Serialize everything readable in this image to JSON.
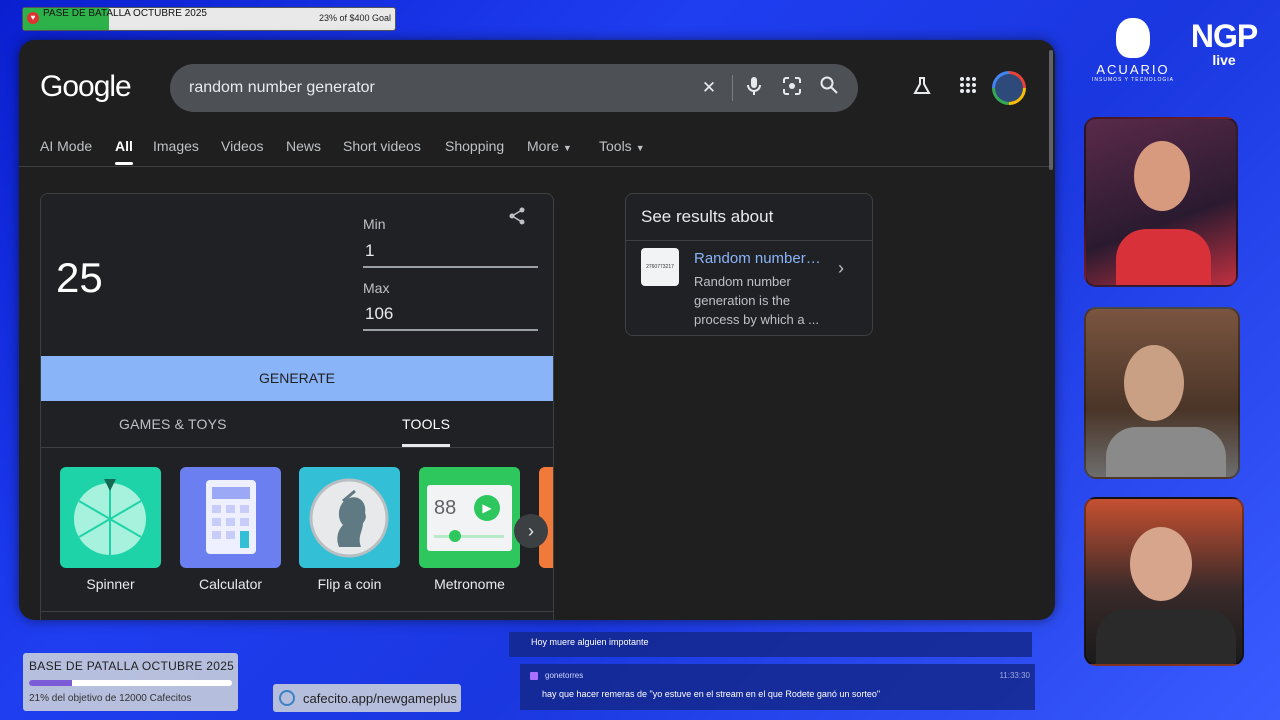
{
  "overlay": {
    "goal_top": {
      "title": "PASE DE BATALLA OCTUBRE 2025",
      "amount": "23% of $400 Goal",
      "progress": 0.23
    },
    "goal_bottom": {
      "title": "BASE DE PATALLA OCTUBRE 2025",
      "subtitle": "21% del objetivo de 12000 Cafecitos",
      "progress": 0.21
    },
    "cafecito": "cafecito.app/newgameplus",
    "brand1": {
      "name": "ACUARIO",
      "tagline": "INSUMOS Y TECNOLOGIA"
    },
    "brand2": {
      "big": "NGP",
      "small": "live"
    },
    "chat": [
      {
        "message": "Hoy muere alguien impotante"
      },
      {
        "user": "gonetorres",
        "time": "11:33:30",
        "message": "hay que hacer remeras de \"yo estuve en el stream en el que Rodete ganó un sorteo\""
      }
    ]
  },
  "google": {
    "logo": "Google",
    "search": {
      "query": "random number generator"
    },
    "tabs": [
      {
        "label": "AI Mode"
      },
      {
        "label": "All",
        "active": true
      },
      {
        "label": "Images"
      },
      {
        "label": "Videos"
      },
      {
        "label": "News"
      },
      {
        "label": "Short videos"
      },
      {
        "label": "Shopping"
      },
      {
        "label": "More"
      },
      {
        "label": "Tools"
      }
    ],
    "rng": {
      "result": "25",
      "min_label": "Min",
      "min_value": "1",
      "max_label": "Max",
      "max_value": "106",
      "generate": "GENERATE",
      "subtabs": [
        "GAMES & TOYS",
        "TOOLS"
      ],
      "tools": [
        {
          "label": "Spinner",
          "color": "#1fd3a8"
        },
        {
          "label": "Calculator",
          "color": "#6c7ff0"
        },
        {
          "label": "Flip a coin",
          "color": "#33c0d6"
        },
        {
          "label": "Metronome",
          "color": "#2ec75e"
        }
      ],
      "metronome_value": "88"
    },
    "about": {
      "heading": "See results about",
      "link": "Random number…",
      "desc": "Random number generation is the process by which a ...",
      "thumb_text": "2760773217"
    }
  },
  "colors": {
    "accent": "#8ab4f8",
    "background": "#1f1f1f"
  }
}
